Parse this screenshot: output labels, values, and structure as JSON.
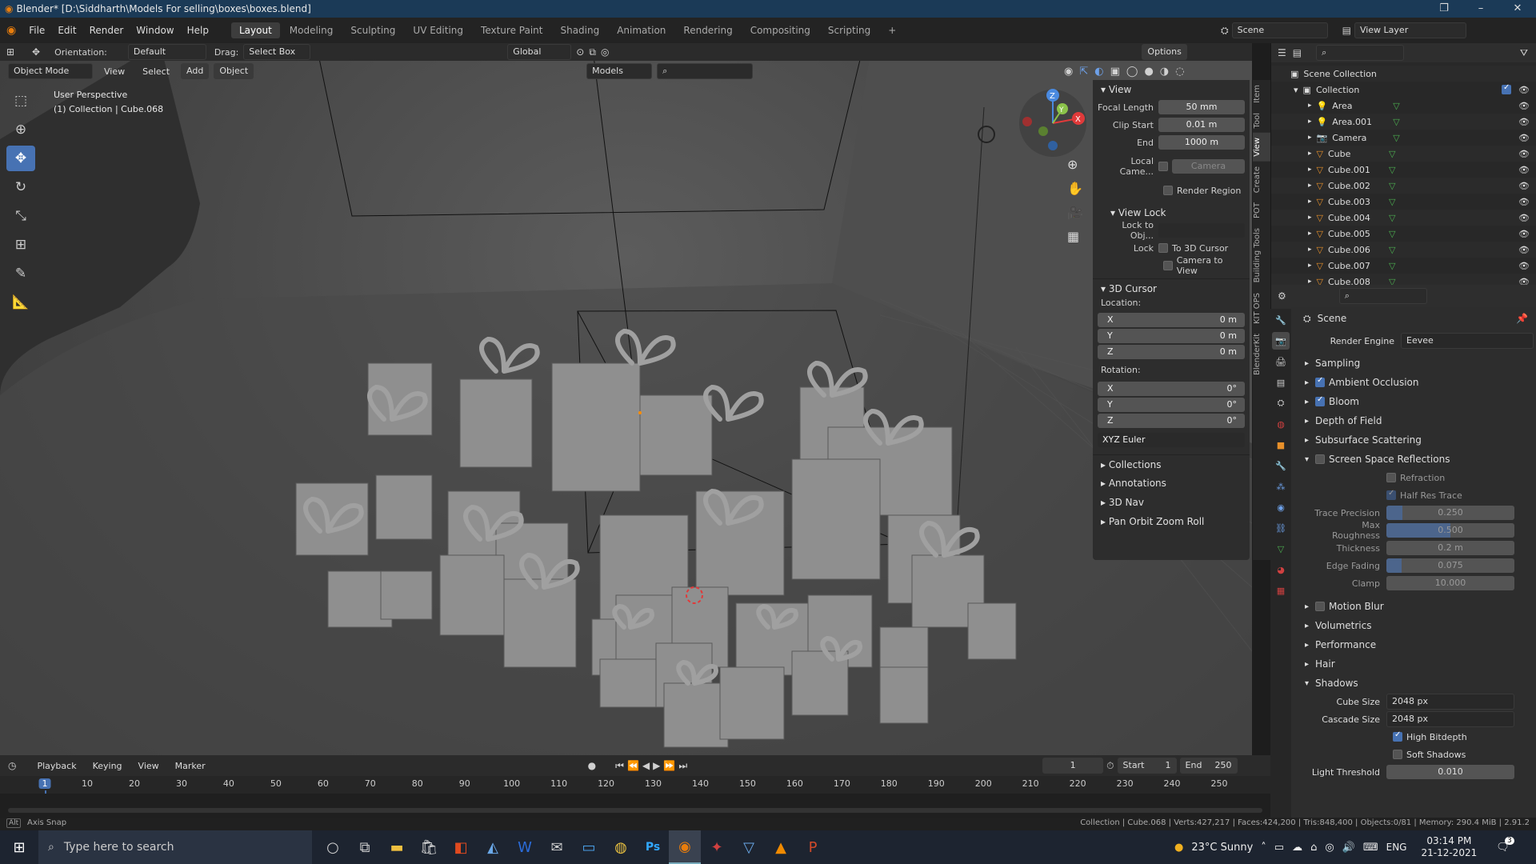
{
  "window": {
    "title": "Blender* [D:\\Siddharth\\Models For selling\\boxes\\boxes.blend]"
  },
  "menubar": {
    "items": [
      "File",
      "Edit",
      "Render",
      "Window",
      "Help"
    ]
  },
  "workspaces": [
    "Layout",
    "Modeling",
    "Sculpting",
    "UV Editing",
    "Texture Paint",
    "Shading",
    "Animation",
    "Rendering",
    "Compositing",
    "Scripting"
  ],
  "scene": {
    "name": "Scene",
    "view_layer": "View Layer"
  },
  "viewport_header": {
    "orientation_label": "Orientation:",
    "orientation_value": "Default",
    "drag_label": "Drag:",
    "drag_value": "Select Box",
    "transform_orientation": "Global",
    "options": "Options",
    "mode": "Object Mode",
    "menus": [
      "View",
      "Select",
      "Add",
      "Object"
    ],
    "collection_filter": "Models"
  },
  "viewport": {
    "perspective": "User Perspective",
    "collection_info": "(1) Collection | Cube.068",
    "gizmo_axes": [
      "X",
      "Y",
      "Z"
    ]
  },
  "npanel": {
    "view_section": "View",
    "focal_length_label": "Focal Length",
    "focal_length": "50 mm",
    "clip_start_label": "Clip Start",
    "clip_start": "0.01 m",
    "clip_end_label": "End",
    "clip_end": "1000 m",
    "local_camera_label": "Local Came...",
    "local_camera_value": "Camera",
    "render_region": "Render Region",
    "view_lock_section": "View Lock",
    "lock_to_obj_label": "Lock to Obj...",
    "lock_label": "Lock",
    "to_3d_cursor": "To 3D Cursor",
    "camera_to_view": "Camera to View",
    "cursor_section": "3D Cursor",
    "location_label": "Location:",
    "location": [
      {
        "axis": "X",
        "value": "0 m"
      },
      {
        "axis": "Y",
        "value": "0 m"
      },
      {
        "axis": "Z",
        "value": "0 m"
      }
    ],
    "rotation_label": "Rotation:",
    "rotation": [
      {
        "axis": "X",
        "value": "0°"
      },
      {
        "axis": "Y",
        "value": "0°"
      },
      {
        "axis": "Z",
        "value": "0°"
      }
    ],
    "rotation_mode": "XYZ Euler",
    "collapsed_sections": [
      "Collections",
      "Annotations",
      "3D Nav",
      "Pan Orbit Zoom Roll"
    ],
    "tabs": [
      "Item",
      "Tool",
      "View",
      "Create",
      "POT",
      "Building Tools",
      "KIT OPS",
      "BlenderKit"
    ]
  },
  "outliner": {
    "root": "Scene Collection",
    "collection": "Collection",
    "items": [
      {
        "name": "Area",
        "type": "light"
      },
      {
        "name": "Area.001",
        "type": "light"
      },
      {
        "name": "Camera",
        "type": "camera"
      },
      {
        "name": "Cube",
        "type": "mesh"
      },
      {
        "name": "Cube.001",
        "type": "mesh"
      },
      {
        "name": "Cube.002",
        "type": "mesh"
      },
      {
        "name": "Cube.003",
        "type": "mesh"
      },
      {
        "name": "Cube.004",
        "type": "mesh"
      },
      {
        "name": "Cube.005",
        "type": "mesh"
      },
      {
        "name": "Cube.006",
        "type": "mesh"
      },
      {
        "name": "Cube.007",
        "type": "mesh"
      },
      {
        "name": "Cube.008",
        "type": "mesh"
      }
    ]
  },
  "properties": {
    "context": "Scene",
    "render_engine_label": "Render Engine",
    "render_engine": "Eevee",
    "sections": [
      {
        "label": "Sampling",
        "checkbox": null,
        "expanded": false
      },
      {
        "label": "Ambient Occlusion",
        "checkbox": true,
        "expanded": false
      },
      {
        "label": "Bloom",
        "checkbox": true,
        "expanded": false
      },
      {
        "label": "Depth of Field",
        "checkbox": null,
        "expanded": false
      },
      {
        "label": "Subsurface Scattering",
        "checkbox": null,
        "expanded": false
      },
      {
        "label": "Screen Space Reflections",
        "checkbox": false,
        "expanded": true
      }
    ],
    "ssr": {
      "refraction": "Refraction",
      "half_res_trace": "Half Res Trace",
      "sliders": [
        {
          "label": "Trace Precision",
          "value": "0.250",
          "fraction": 0.125
        },
        {
          "label": "Max Roughness",
          "value": "0.500",
          "fraction": 0.5
        },
        {
          "label": "Thickness",
          "value": "0.2 m",
          "fraction": 0
        },
        {
          "label": "Edge Fading",
          "value": "0.075",
          "fraction": 0.12
        },
        {
          "label": "Clamp",
          "value": "10.000",
          "fraction": 0
        }
      ]
    },
    "sections2": [
      {
        "label": "Motion Blur",
        "checkbox": false
      },
      {
        "label": "Volumetrics",
        "checkbox": null
      },
      {
        "label": "Performance",
        "checkbox": null
      },
      {
        "label": "Hair",
        "checkbox": null
      }
    ],
    "shadows": {
      "label": "Shadows",
      "cube_size_label": "Cube Size",
      "cube_size": "2048 px",
      "cascade_size_label": "Cascade Size",
      "cascade_size": "2048 px",
      "high_bitdepth": "High Bitdepth",
      "soft_shadows": "Soft Shadows",
      "light_threshold_label": "Light Threshold",
      "light_threshold": "0.010"
    }
  },
  "timeline": {
    "menus": [
      "Playback",
      "Keying",
      "View",
      "Marker"
    ],
    "current_frame": "1",
    "start_label": "Start",
    "start": "1",
    "end_label": "End",
    "end": "250",
    "ticks": [
      "1",
      "10",
      "20",
      "30",
      "40",
      "50",
      "60",
      "70",
      "80",
      "90",
      "100",
      "110",
      "120",
      "130",
      "140",
      "150",
      "160",
      "170",
      "180",
      "190",
      "200",
      "210",
      "220",
      "230",
      "240",
      "250"
    ]
  },
  "statusbar": {
    "left": "Axis Snap",
    "right": "Collection | Cube.068 | Verts:427,217 | Faces:424,200 | Tris:848,400 | Objects:0/81 | Memory: 290.4 MiB | 2.91.2"
  },
  "taskbar": {
    "search_placeholder": "Type here to search",
    "weather": "23°C  Sunny",
    "language": "ENG",
    "time": "03:14 PM",
    "date": "21-12-2021",
    "notifications": "3"
  }
}
